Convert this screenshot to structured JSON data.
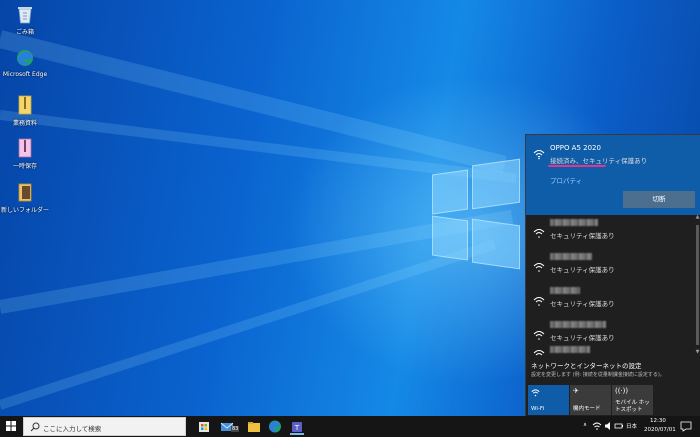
{
  "desktop": {
    "icons": [
      {
        "label": "ごみ箱",
        "icon": "recycle-bin-icon"
      },
      {
        "label": "Microsoft Edge",
        "icon": "edge-icon"
      },
      {
        "label": "業務資料",
        "icon": "document-zip-icon"
      },
      {
        "label": "一時保存",
        "icon": "document-zip-icon"
      },
      {
        "label": "新しいフォルダー",
        "icon": "folder-icon"
      }
    ]
  },
  "flyout": {
    "connected": {
      "name": "OPPO A5 2020",
      "status": "接続済み、セキュリティ保護あり",
      "properties_label": "プロパティ",
      "disconnect_label": "切断"
    },
    "networks": [
      {
        "status": "セキュリティ保護あり"
      },
      {
        "status": "セキュリティ保護あり"
      },
      {
        "status": "セキュリティ保護あり"
      },
      {
        "status": "セキュリティ保護あり"
      }
    ],
    "settings_link": "ネットワークとインターネットの設定",
    "settings_sub": "設定を変更します (例: 接続を従量制課金接続に設定する)。",
    "tiles": [
      {
        "label": "Wi-Fi",
        "icon": "wifi-icon",
        "active": true
      },
      {
        "label": "機内モード",
        "icon": "airplane-icon",
        "active": false
      },
      {
        "label": "モバイル ホットスポット",
        "icon": "hotspot-icon",
        "active": false
      }
    ]
  },
  "taskbar": {
    "search_placeholder": "ここに入力して検索",
    "badge_count": "83",
    "ime_label": "日本",
    "time": "12:30",
    "date": "2020/07/01"
  },
  "colors": {
    "connected_bg": "#0f5da8",
    "accent_tile": "#0f5da8",
    "underline": "#e4348c",
    "taskbar": "#151515"
  }
}
